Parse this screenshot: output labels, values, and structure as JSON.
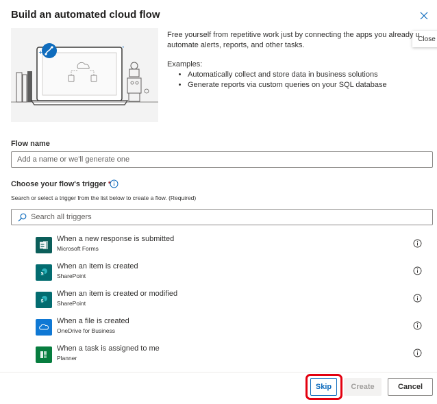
{
  "dialog": {
    "title": "Build an automated cloud flow",
    "close_tooltip": "Close"
  },
  "intro": {
    "description_line1": "Free yourself from repetitive work just by connecting the apps you already u",
    "description_line2": "automate alerts, reports, and other tasks.",
    "examples_label": "Examples:",
    "examples": [
      "Automatically collect and store data in business solutions",
      "Generate reports via custom queries on your SQL database"
    ]
  },
  "flow_name": {
    "label": "Flow name",
    "placeholder": "Add a name or we'll generate one",
    "value": ""
  },
  "trigger": {
    "label": "Choose your flow's trigger",
    "required_mark": "*",
    "help_text": "Search or select a trigger from the list below to create a flow. (Required)",
    "search_placeholder": "Search all triggers",
    "items": [
      {
        "title": "When a new response is submitted",
        "connector": "Microsoft Forms",
        "icon": "forms-icon",
        "color": "#0b5e5a"
      },
      {
        "title": "When an item is created",
        "connector": "SharePoint",
        "icon": "sharepoint-icon",
        "color": "#036c70"
      },
      {
        "title": "When an item is created or modified",
        "connector": "SharePoint",
        "icon": "sharepoint-icon",
        "color": "#036c70"
      },
      {
        "title": "When a file is created",
        "connector": "OneDrive for Business",
        "icon": "onedrive-icon",
        "color": "#0f78d4"
      },
      {
        "title": "When a task is assigned to me",
        "connector": "Planner",
        "icon": "planner-icon",
        "color": "#077d3f"
      }
    ]
  },
  "footer": {
    "skip_label": "Skip",
    "create_label": "Create",
    "cancel_label": "Cancel"
  },
  "colors": {
    "accent": "#0f6cbd",
    "highlight": "#e3000f",
    "required": "#a4262c"
  }
}
